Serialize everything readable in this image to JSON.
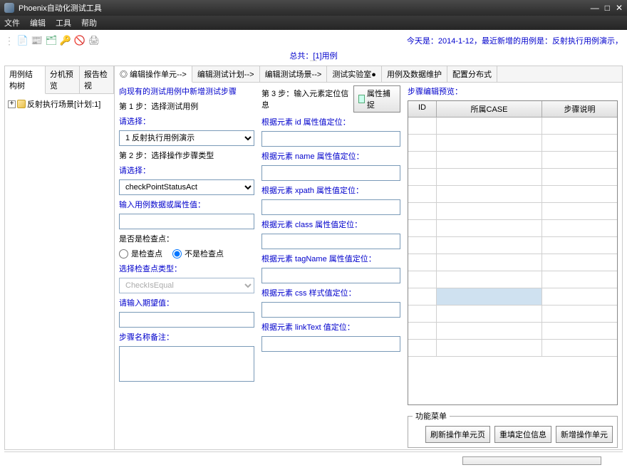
{
  "title": "Phoenix自动化测试工具",
  "menu": [
    "文件",
    "编辑",
    "工具",
    "帮助"
  ],
  "status_today": "今天是：2014-1-12，最近新增的用例是：反射执行用例演示，",
  "summary": "总共：[1]用例",
  "left_tabs": [
    "用例结构树",
    "分机预览",
    "报告检视"
  ],
  "tree_item": "反射执行场景[计划:1]",
  "right_tabs": [
    "◎ 编辑操作单元-->",
    "编辑测试计划-->",
    "编辑测试场景-->",
    "测试实验室●",
    "用例及数据维护",
    "配置分布式"
  ],
  "form_heading": "向现有的测试用例中新增测试步骤",
  "step1": "第 1 步：选择测试用例",
  "please_select": "请选择：",
  "sel_usecase": "1 反射执行用例演示",
  "step2": "第 2 步：选择操作步骤类型",
  "sel_action": "checkPointStatusAct",
  "input_data_label": "输入用例数据或属性值：",
  "is_checkpoint_label": "是否是检查点：",
  "radio_yes": "是检查点",
  "radio_no": "不是检查点",
  "checkpoint_type_label": "选择检查点类型：",
  "sel_checktype": "CheckIsEqual",
  "expected_label": "请输入期望值：",
  "remark_label": "步骤名称备注：",
  "step3": "第 3 步：输入元素定位信息",
  "capture_btn": "属性捕捉",
  "loc_id": "根据元素 id 属性值定位：",
  "loc_name": "根据元素 name 属性值定位：",
  "loc_xpath": "根据元素 xpath 属性值定位：",
  "loc_class": "根据元素 class 属性值定位：",
  "loc_tagname": "根据元素 tagName 属性值定位：",
  "loc_css": "根据元素 css 样式值定位：",
  "loc_linktext": "根据元素 linkText 值定位：",
  "preview_label": "步骤编辑预览：",
  "table_headers": {
    "id": "ID",
    "case": "所属CASE",
    "desc": "步骤说明"
  },
  "func_legend": "功能菜单",
  "btn_refresh": "刷新操作单元页",
  "btn_reset": "重填定位信息",
  "btn_add": "新增操作单元"
}
